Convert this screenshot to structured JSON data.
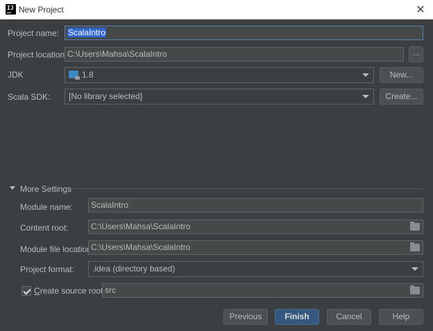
{
  "window": {
    "title": "New Project",
    "close_glyph": "✕"
  },
  "form": {
    "project_name": {
      "label": "Project name:",
      "value": "ScalaIntro"
    },
    "project_location": {
      "label": "Project location:",
      "value": "C:\\Users\\Mahsa\\ScalaIntro",
      "browse_label": "..."
    },
    "jdk": {
      "label": "JDK",
      "value": "1.8",
      "new_label": "New..."
    },
    "scala_sdk": {
      "label": "Scala SDK:",
      "value": "[No library selected]",
      "create_label": "Create..."
    }
  },
  "more_settings": {
    "label": "More Settings",
    "module_name": {
      "label": "Module name:",
      "value": "ScalaIntro"
    },
    "content_root": {
      "label": "Content root:",
      "value": "C:\\Users\\Mahsa\\ScalaIntro"
    },
    "module_file_location": {
      "label": "Module file location:",
      "value": "C:\\Users\\Mahsa\\ScalaIntro"
    },
    "project_format": {
      "label": "Project format:",
      "value": ".idea (directory based)"
    },
    "create_source_root": {
      "label_first": "C",
      "label_rest": "reate source root:",
      "checked": true,
      "value": "src"
    }
  },
  "buttons": {
    "previous": "Previous",
    "finish": "Finish",
    "cancel": "Cancel",
    "help": "Help"
  },
  "colors": {
    "background": "#3c3f41",
    "field": "#45494a",
    "primary_button": "#365880",
    "selection": "#2f65ca"
  }
}
